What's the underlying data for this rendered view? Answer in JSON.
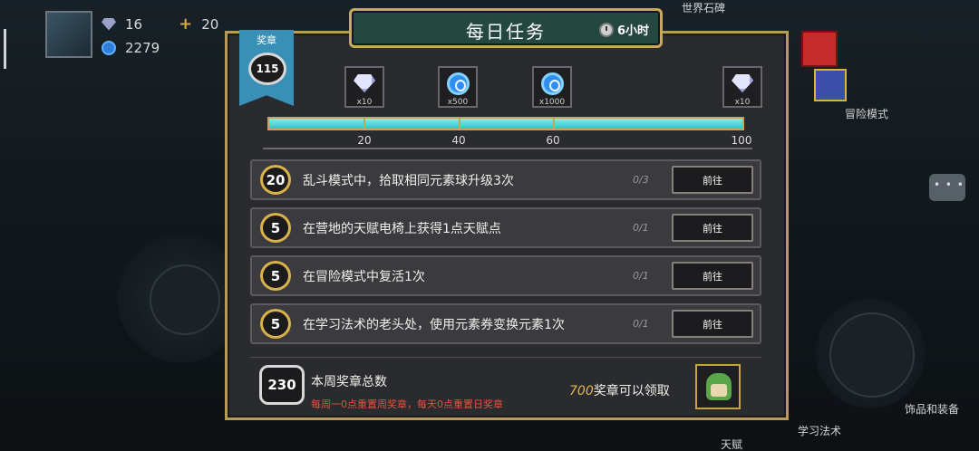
{
  "hud": {
    "gems": "16",
    "coins": "2279",
    "energy": "20"
  },
  "background": {
    "sign": "世界石碑",
    "adventure": "冒险模式",
    "learn_magic": "学习法术",
    "accessories": "饰品和装备",
    "talent": "天赋"
  },
  "panel": {
    "title": "每日任务",
    "timer": "6小时",
    "ribbon_label": "奖章",
    "medal_total": "115"
  },
  "rewards": [
    {
      "type": "gem",
      "amount": "x10"
    },
    {
      "type": "coin",
      "amount": "x500"
    },
    {
      "type": "coin",
      "amount": "x1000"
    },
    {
      "type": "gem",
      "amount": "x10"
    }
  ],
  "progress": {
    "value": 115,
    "max": 100,
    "ticks": [
      "20",
      "40",
      "60",
      "100"
    ]
  },
  "tasks": [
    {
      "points": "20",
      "text": "乱斗模式中，拾取相同元素球升级3次",
      "count": "0/3",
      "button": "前往"
    },
    {
      "points": "5",
      "text": "在营地的天赋电椅上获得1点天赋点",
      "count": "0/1",
      "button": "前往"
    },
    {
      "points": "5",
      "text": "在冒险模式中复活1次",
      "count": "0/1",
      "button": "前往"
    },
    {
      "points": "5",
      "text": "在学习法术的老头处，使用元素券变换元素1次",
      "count": "0/1",
      "button": "前往"
    }
  ],
  "footer": {
    "weekly_total": "230",
    "weekly_title": "本周奖章总数",
    "weekly_note": "每周一0点重置周奖章，每天0点重置日奖章",
    "claim_number": "700",
    "claim_text": "奖章可以领取"
  },
  "colors": {
    "accent_gold": "#c9a95b",
    "title_bg": "#24483f",
    "progress_fill": "#2ec7bb",
    "warning_red": "#e3533f"
  }
}
